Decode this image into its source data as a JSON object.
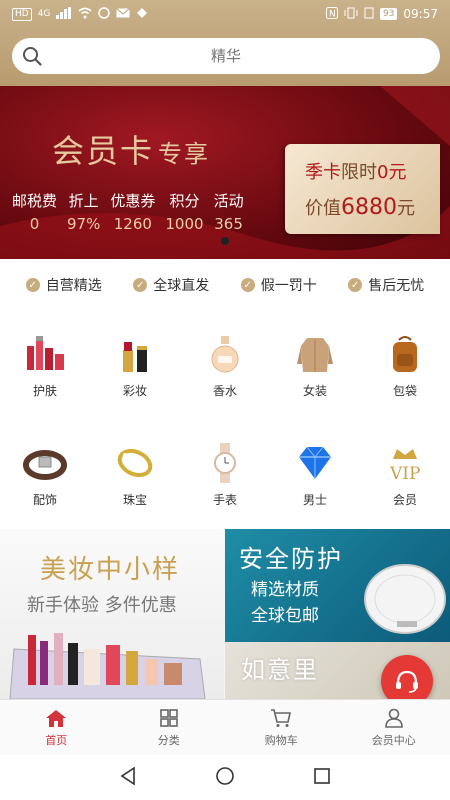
{
  "status_bar": {
    "network_badge": "HD",
    "network_type": "4G",
    "battery": "93",
    "time": "09:57"
  },
  "search": {
    "placeholder": "精华"
  },
  "banner": {
    "title": "会员卡",
    "title_suffix": "专享",
    "stats": [
      {
        "label": "邮税费",
        "value": "0"
      },
      {
        "label": "折上",
        "value": "97%"
      },
      {
        "label": "优惠券",
        "value": "1260"
      },
      {
        "label": "积分",
        "value": "1000"
      },
      {
        "label": "活动",
        "value": "365"
      }
    ],
    "card": {
      "line1_a": "季卡",
      "line1_b": "限时",
      "line1_c": "0元",
      "line2_a": "价值",
      "line2_b": "6880",
      "line2_c": "元"
    }
  },
  "guarantees": [
    "自营精选",
    "全球直发",
    "假一罚十",
    "售后无忧"
  ],
  "categories": [
    {
      "label": "护肤",
      "icon": "skincare-icon"
    },
    {
      "label": "彩妆",
      "icon": "lipstick-icon"
    },
    {
      "label": "香水",
      "icon": "perfume-icon"
    },
    {
      "label": "女装",
      "icon": "coat-icon"
    },
    {
      "label": "包袋",
      "icon": "backpack-icon"
    },
    {
      "label": "配饰",
      "icon": "belt-icon"
    },
    {
      "label": "珠宝",
      "icon": "bracelet-icon"
    },
    {
      "label": "手表",
      "icon": "watch-icon"
    },
    {
      "label": "男士",
      "icon": "diamond-icon"
    },
    {
      "label": "会员",
      "icon": "vip-crown-icon"
    }
  ],
  "promos": {
    "left": {
      "title": "美妆中小样",
      "subtitle": "新手体验  多件优惠"
    },
    "right_top": {
      "title": "安全防护",
      "line1": "精选材质",
      "line2": "全球包邮"
    },
    "right_bottom": {
      "title": "如意里"
    }
  },
  "tabbar": [
    {
      "label": "首页",
      "icon": "home-icon",
      "active": true
    },
    {
      "label": "分类",
      "icon": "category-grid-icon",
      "active": false
    },
    {
      "label": "购物车",
      "icon": "cart-icon",
      "active": false
    },
    {
      "label": "会员中心",
      "icon": "user-icon",
      "active": false
    }
  ],
  "colors": {
    "accent_gold": "#c8ac7e",
    "banner_red": "#8a0f16",
    "active_tab": "#d3333b",
    "promo_teal": "#1a7f9a"
  }
}
